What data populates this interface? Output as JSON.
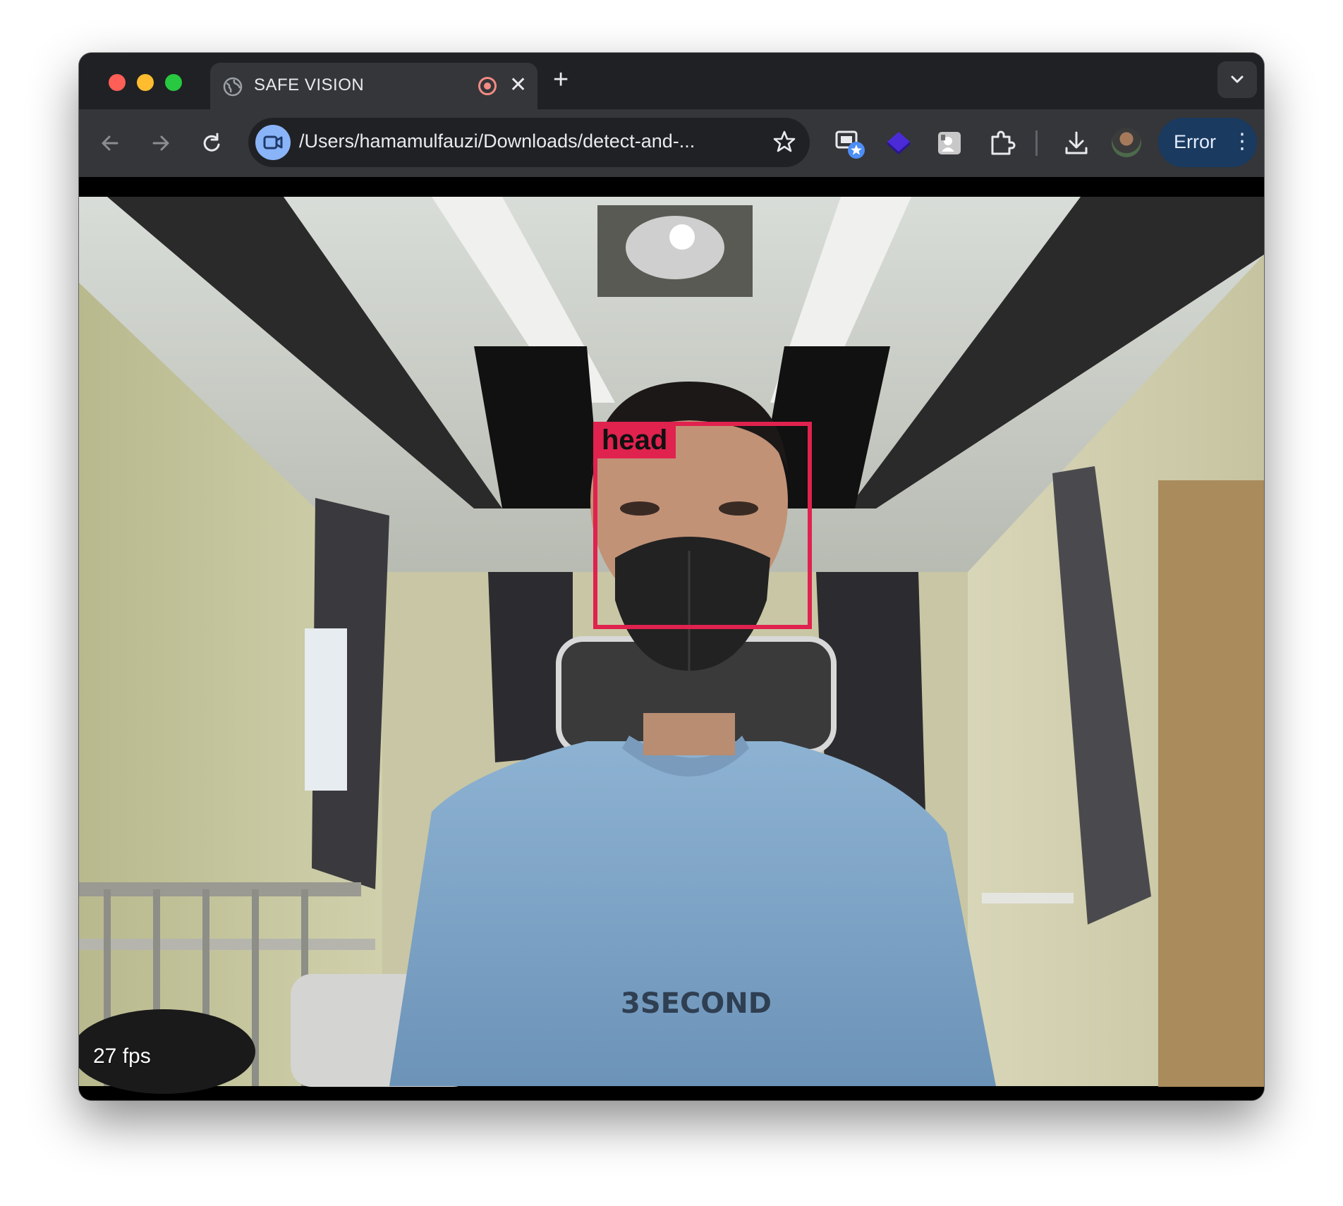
{
  "browser": {
    "tab": {
      "title": "SAFE VISION",
      "recording_indicator": "record-icon",
      "close_glyph": "✕"
    },
    "new_tab_glyph": "+",
    "address_bar": {
      "url": "/Users/hamamulfauzi/Downloads/detect-and-..."
    },
    "profile_chip": {
      "label": "Error",
      "menu_glyph": "⋮"
    },
    "extensions": [
      "picture-in-picture-star-icon",
      "layers-icon",
      "portrait-icon",
      "puzzle-icon"
    ],
    "colors": {
      "tabstrip": "#202124",
      "toolbar": "#35363a",
      "error_chip": "#1a3a5f"
    }
  },
  "video": {
    "fps_text": "27 fps",
    "detection": {
      "label": "head",
      "color": "#e0224e"
    },
    "shirt_text": "3SECOND"
  }
}
